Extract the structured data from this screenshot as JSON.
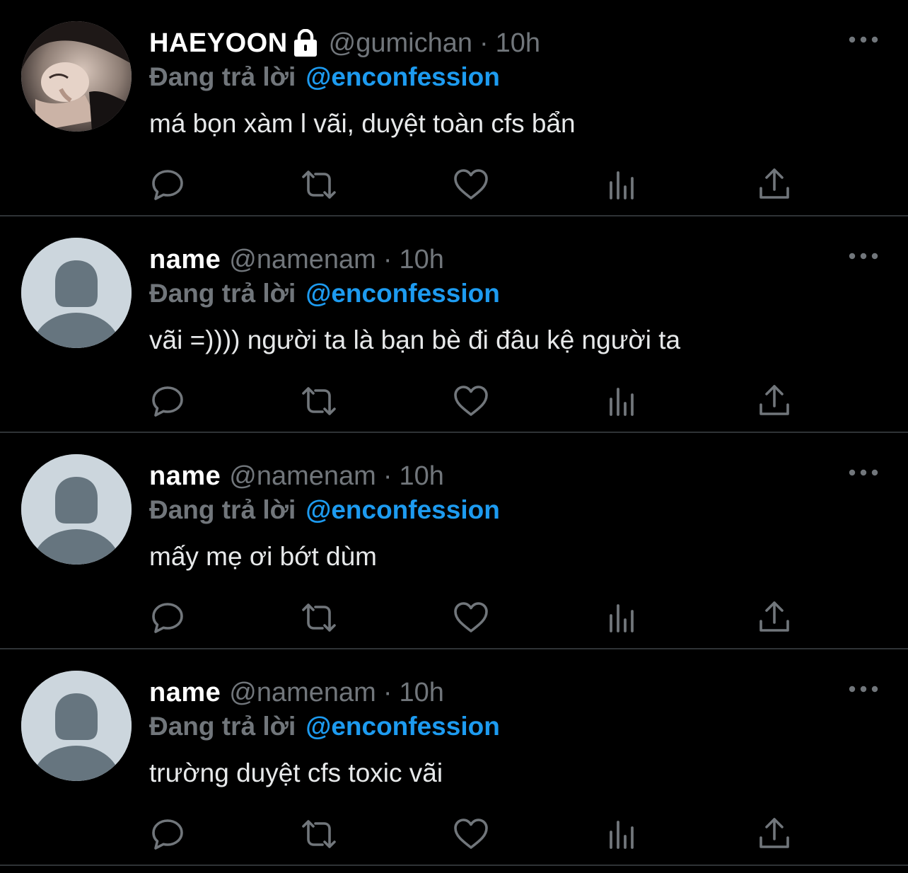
{
  "tweets": [
    {
      "display_name": "HAEYOON",
      "protected": true,
      "handle": "@gumichan",
      "separator": "·",
      "time": "10h",
      "reply_prefix": "Đang trả lời",
      "reply_target": "@enconfession",
      "text": "má bọn xàm l vãi, duyệt toàn cfs bẩn",
      "avatar": "photo"
    },
    {
      "display_name": "name",
      "protected": false,
      "handle": "@namenam",
      "separator": "·",
      "time": "10h",
      "reply_prefix": "Đang trả lời",
      "reply_target": "@enconfession",
      "text": "vãi =)))) người ta là bạn bè đi đâu kệ người ta",
      "avatar": "default"
    },
    {
      "display_name": "name",
      "protected": false,
      "handle": "@namenam",
      "separator": "·",
      "time": "10h",
      "reply_prefix": "Đang trả lời",
      "reply_target": "@enconfession",
      "text": "mấy mẹ ơi bớt dùm",
      "avatar": "default"
    },
    {
      "display_name": "name",
      "protected": false,
      "handle": "@namenam",
      "separator": "·",
      "time": "10h",
      "reply_prefix": "Đang trả lời",
      "reply_target": "@enconfession",
      "text": "trường duyệt cfs toxic vãi",
      "avatar": "default"
    }
  ],
  "actions": [
    "reply-icon",
    "retweet-icon",
    "like-icon",
    "analytics-icon",
    "share-icon"
  ],
  "colors": {
    "background": "#000000",
    "secondary_text": "#71767b",
    "accent": "#1d9bf0",
    "divider": "#2f3336",
    "default_avatar_bg": "#ccd6dd",
    "default_avatar_fg": "#66757f"
  }
}
